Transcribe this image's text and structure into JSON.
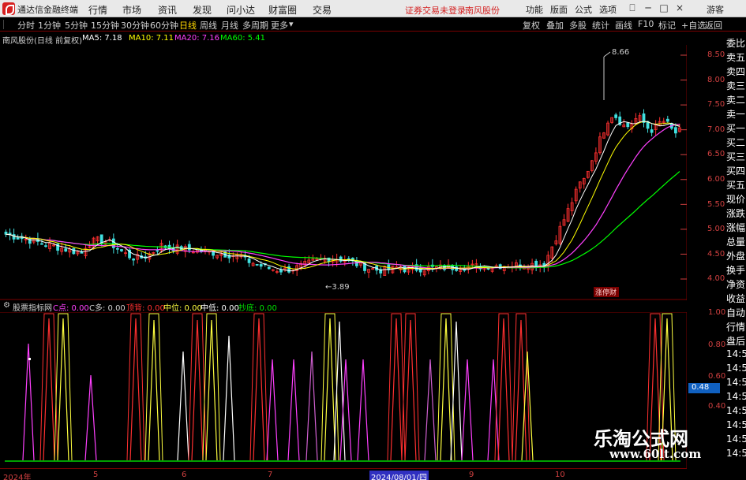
{
  "titlebar": {
    "app_title": "通达信金融终端",
    "menus": [
      "行情",
      "市场",
      "资讯",
      "发现",
      "问小达",
      "财富圈",
      "交易"
    ],
    "notice": "证券交易未登录",
    "stock": "南风股份",
    "tools": [
      "功能",
      "版面",
      "公式",
      "选项"
    ],
    "window_controls": [
      "⎕",
      "─",
      "□",
      "×"
    ],
    "guest": "游客"
  },
  "toolbar": {
    "periods": [
      "分时",
      "1分钟",
      "5分钟",
      "15分钟",
      "30分钟",
      "60分钟",
      "日线",
      "周线",
      "月线",
      "多周期",
      "更多"
    ],
    "active_period": "日线",
    "right_tools": [
      "复权",
      "叠加",
      "多股",
      "统计",
      "画线",
      "F10",
      "标记",
      "+自选",
      "返回"
    ]
  },
  "infobar": {
    "stock": "南风股份(日线 前复权)",
    "ma5": "MA5: 7.18",
    "ma10": "MA10: 7.11",
    "ma20": "MA20: 7.16",
    "ma60": "MA60: 5.41"
  },
  "main_chart": {
    "price_axis": [
      "8.50",
      "8.00",
      "7.50",
      "7.00",
      "6.50",
      "6.00",
      "5.50",
      "5.00",
      "4.50",
      "4.00"
    ],
    "high_label": "8.66",
    "low_label": "←3.89",
    "badge": "涨停财"
  },
  "indicator": {
    "name": "股票指标网",
    "c_dian": "C点: 0.00",
    "c_duo": "C多: 0.00",
    "ding_bei": "顶背: 0.00",
    "zhong_wei": "中位: 0.00",
    "zhong_di": "中低: 0.00",
    "chao_di": "抄底: 0.00",
    "axis": [
      "1.00",
      "0.80",
      "0.60",
      "0.40"
    ],
    "value_box": "0.48"
  },
  "side_panel": [
    "委比",
    "卖五",
    "卖四",
    "卖三",
    "卖二",
    "卖一",
    "买一",
    "买二",
    "买三",
    "买四",
    "买五",
    "现价",
    "涨跌",
    "涨幅",
    "总量",
    "外盘",
    "换手",
    "净资",
    "收益",
    "自动",
    "行情",
    "盘后",
    "14:50",
    "14:51",
    "14:52",
    "14:53",
    "14:54",
    "14:55",
    "14:56",
    "14:57"
  ],
  "dates": [
    "2024年",
    "5",
    "6",
    "7",
    "2024/08/01/四",
    "9",
    "10"
  ],
  "watermark": {
    "cn": "乐淘公式网",
    "url": "www.60lt.com"
  },
  "colors": {
    "up": "#ff3030",
    "down": "#40e0e0",
    "ma5": "#ffffff",
    "ma10": "#ffff00",
    "ma20": "#ff40ff",
    "ma60": "#00ff00",
    "axis": "#d04040",
    "grid": "#7a0000"
  }
}
